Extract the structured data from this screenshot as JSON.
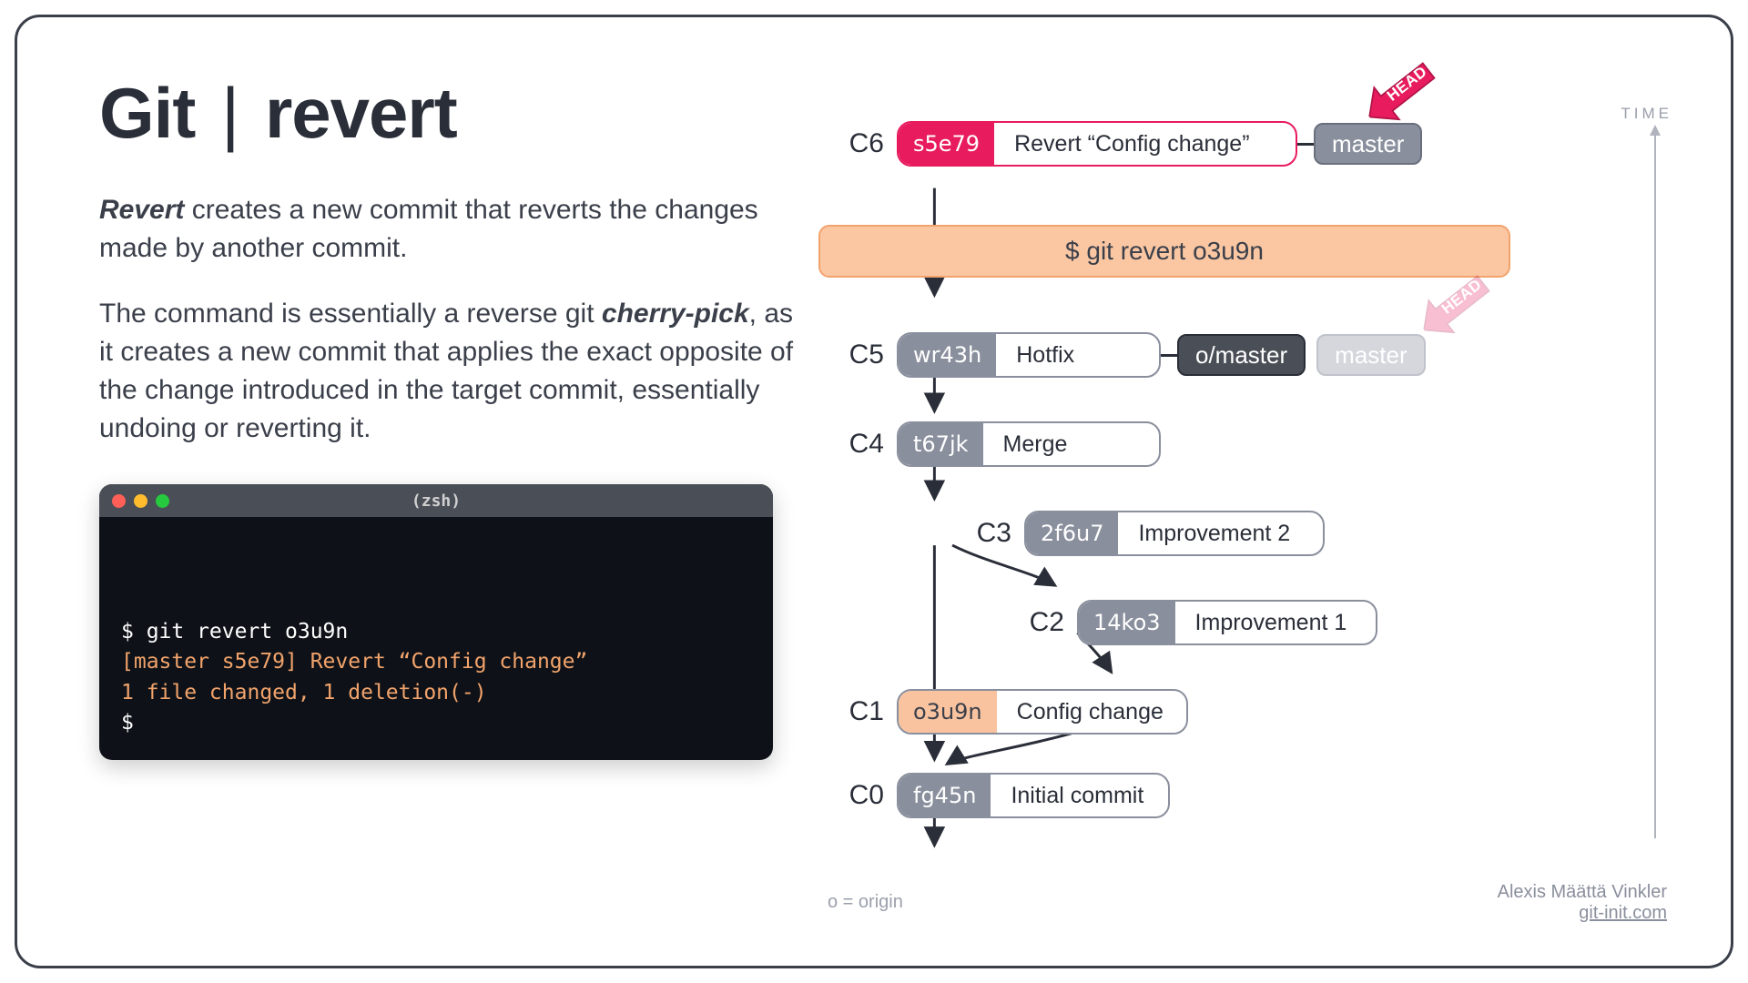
{
  "title_prefix": "Git",
  "title_suffix": "revert",
  "para1_strong": "Revert",
  "para1_rest": " creates a new commit that reverts the changes made by another commit.",
  "para2_a": "The command is essentially a reverse git ",
  "para2_strong": "cherry-pick",
  "para2_b": ", as it creates a new commit that applies the exact opposite of the change introduced in the target commit, essentially undoing or reverting it.",
  "terminal": {
    "shell": "(zsh)",
    "line1": "$ git revert o3u9n",
    "line2": "[master s5e79] Revert “Config change”",
    "line3": "1 file changed, 1 deletion(-)",
    "prompt": "$"
  },
  "cmd_band": "$ git revert o3u9n",
  "commits": {
    "c6": {
      "label": "C6",
      "hash": "s5e79",
      "msg": "Revert “Config change”"
    },
    "c5": {
      "label": "C5",
      "hash": "wr43h",
      "msg": "Hotfix"
    },
    "c4": {
      "label": "C4",
      "hash": "t67jk",
      "msg": "Merge"
    },
    "c3": {
      "label": "C3",
      "hash": "2f6u7",
      "msg": "Improvement 2"
    },
    "c2": {
      "label": "C2",
      "hash": "14ko3",
      "msg": "Improvement 1"
    },
    "c1": {
      "label": "C1",
      "hash": "o3u9n",
      "msg": "Config change"
    },
    "c0": {
      "label": "C0",
      "hash": "fg45n",
      "msg": "Initial commit"
    }
  },
  "tags": {
    "master": "master",
    "o_master": "o/master",
    "master_faded": "master"
  },
  "head_label": "HEAD",
  "time_label": "TIME",
  "legend": "o = origin",
  "credit_name": "Alexis Määttä Vinkler",
  "credit_link": "git-init.com"
}
